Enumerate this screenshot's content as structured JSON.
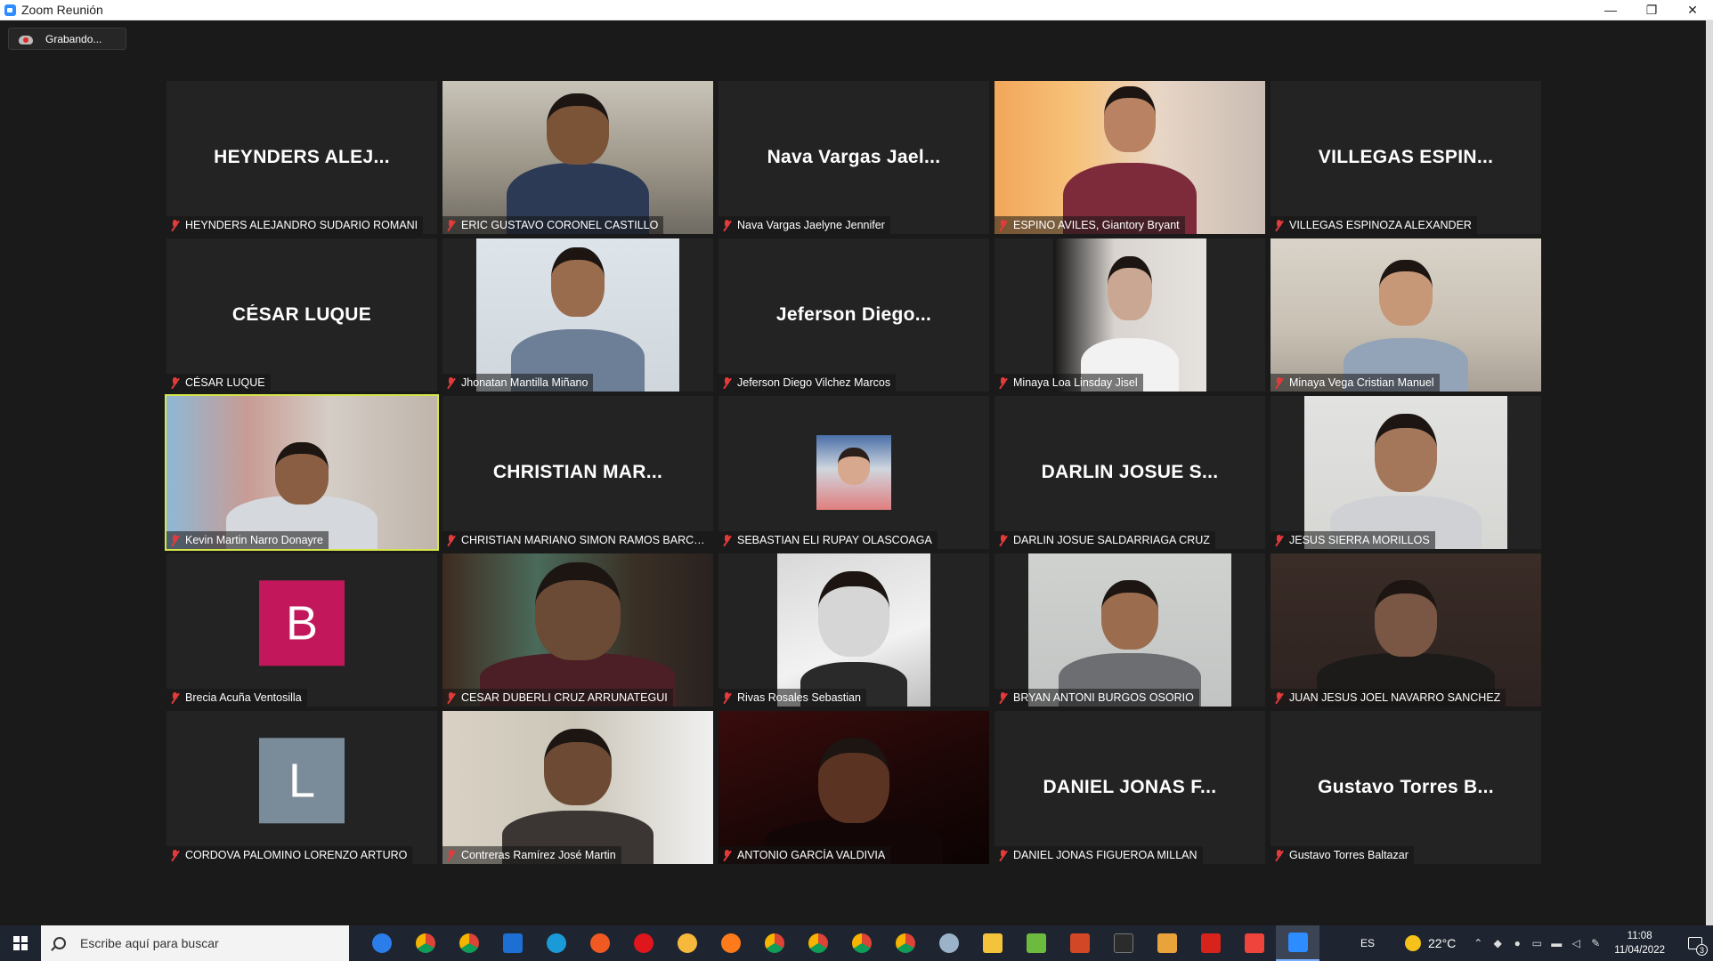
{
  "window": {
    "title": "Zoom Reunión",
    "minimize": "—",
    "restore": "❐",
    "close": "✕"
  },
  "recording": {
    "label": "Grabando..."
  },
  "participants": [
    {
      "big": "HEYNDERS  ALEJ...",
      "name": "HEYNDERS ALEJANDRO SUDARIO ROMANI",
      "kind": "name"
    },
    {
      "big": "",
      "name": "ERIC GUSTAVO CORONEL CASTILLO",
      "kind": "video"
    },
    {
      "big": "Nava Vargas Jael...",
      "name": "Nava Vargas Jaelyne Jennifer",
      "kind": "name"
    },
    {
      "big": "",
      "name": "ESPINO AVILES, Giantory Bryant",
      "kind": "video"
    },
    {
      "big": "VILLEGAS  ESPIN...",
      "name": "VILLEGAS ESPINOZA ALEXANDER",
      "kind": "name"
    },
    {
      "big": "CÉSAR LUQUE",
      "name": "CÉSAR LUQUE",
      "kind": "name"
    },
    {
      "big": "",
      "name": "Jhonatan Mantilla Miñano",
      "kind": "video"
    },
    {
      "big": "Jeferson  Diego...",
      "name": "Jeferson Diego Vilchez Marcos",
      "kind": "name"
    },
    {
      "big": "",
      "name": "Minaya Loa Linsday Jisel",
      "kind": "video"
    },
    {
      "big": "",
      "name": "Minaya Vega Cristian Manuel",
      "kind": "video"
    },
    {
      "big": "",
      "name": "Kevin Martin Narro Donayre",
      "kind": "video"
    },
    {
      "big": "CHRISTIAN  MAR...",
      "name": "CHRISTIAN MARIANO SIMON RAMOS BARCE...",
      "kind": "name"
    },
    {
      "big": "",
      "name": "SEBASTIAN ELI RUPAY OLASCOAGA",
      "kind": "photo"
    },
    {
      "big": "DARLIN JOSUE S...",
      "name": "DARLIN JOSUE SALDARRIAGA CRUZ",
      "kind": "name"
    },
    {
      "big": "",
      "name": "JESUS SIERRA MORILLOS",
      "kind": "video"
    },
    {
      "big": "B",
      "name": "Brecia Acuña Ventosilla",
      "kind": "letter"
    },
    {
      "big": "",
      "name": "CESAR DUBERLI CRUZ ARRUNATEGUI",
      "kind": "video"
    },
    {
      "big": "",
      "name": "Rivas Rosales Sebastian",
      "kind": "video"
    },
    {
      "big": "",
      "name": "BRYAN ANTONI BURGOS OSORIO",
      "kind": "video"
    },
    {
      "big": "",
      "name": "JUAN JESUS JOEL NAVARRO SANCHEZ",
      "kind": "video"
    },
    {
      "big": "L",
      "name": "CORDOVA PALOMINO LORENZO ARTURO",
      "kind": "letter"
    },
    {
      "big": "",
      "name": "Contreras Ramírez  José Martin",
      "kind": "video"
    },
    {
      "big": "",
      "name": "ANTONIO GARCÍA VALDIVIA",
      "kind": "video"
    },
    {
      "big": "DANIEL JONAS F...",
      "name": "DANIEL JONAS FIGUEROA MILLAN",
      "kind": "name"
    },
    {
      "big": "Gustavo Torres B...",
      "name": "Gustavo Torres Baltazar",
      "kind": "name"
    }
  ],
  "colors": {
    "active_speaker_border": "#d6e64a",
    "avatar_b": "#c2185b",
    "avatar_l": "#7a8c99",
    "mic_muted": "#e23b3b"
  },
  "taskbar": {
    "search_placeholder": "Escribe aquí para buscar",
    "icons": [
      "cortana-icon",
      "chrome-icon",
      "chrome-icon",
      "mail-icon",
      "edge-icon",
      "brave-icon",
      "opera-icon",
      "vpn-icon",
      "firefox-icon",
      "chrome-icon",
      "chrome-icon",
      "chrome-icon",
      "chrome-icon",
      "paint-icon",
      "file-explorer-icon",
      "notepad-icon",
      "powerpoint-icon",
      "terminal-icon",
      "sublime-icon",
      "acrobat-icon",
      "anydesk-icon",
      "zoom-icon"
    ],
    "language": "ES",
    "temperature": "22°C",
    "time": "11:08",
    "date": "11/04/2022",
    "notifications": "3"
  }
}
